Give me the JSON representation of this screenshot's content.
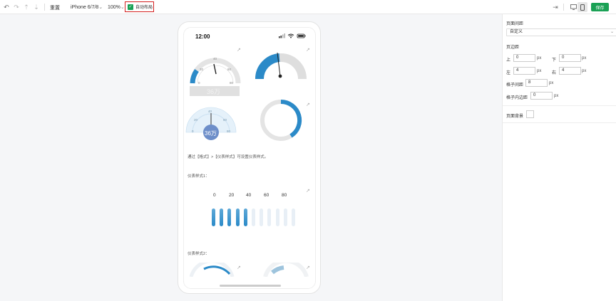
{
  "toolbar": {
    "reset_label": "重置",
    "device_label": "iPhone 6/7/8",
    "zoom_label": "100%",
    "auto_layout_label": "自动布局",
    "save_label": "保存"
  },
  "phone": {
    "time": "12:00",
    "gauge1": {
      "ticks": [
        "0",
        "20",
        "40",
        "60",
        "80"
      ],
      "value_label": "36万"
    },
    "gauge3": {
      "ticks": [
        "0",
        "20",
        "40",
        "60",
        "80"
      ],
      "value_label": "36万"
    },
    "note": "通过【格式】>【仪表样式】可设置仪表样式。",
    "style1_label": "仪表样式1：",
    "style1_ticks": [
      "0",
      "20",
      "40",
      "60",
      "80"
    ],
    "style1_filled_bars": 5,
    "style1_total_bars": 11,
    "style2_label": "仪表样式2："
  },
  "panel": {
    "page_spacing_title": "页面间距",
    "spacing_mode": "自定义",
    "margin_title": "页边距",
    "top_label": "上",
    "top_value": "0",
    "bottom_label": "下",
    "bottom_value": "0",
    "left_label": "左",
    "left_value": "4",
    "right_label": "右",
    "right_value": "4",
    "unit": "px",
    "cell_gap_label": "格子间距",
    "cell_gap_value": "8",
    "cell_padding_label": "格子内边距",
    "cell_padding_value": "0",
    "bg_label": "页面背景"
  },
  "colors": {
    "accent": "#1aa155",
    "gauge_blue": "#2b8ac8",
    "highlight": "#d32020"
  }
}
